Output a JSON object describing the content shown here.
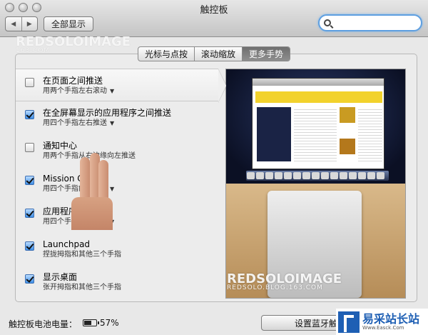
{
  "window": {
    "title": "触控板"
  },
  "toolbar": {
    "back_label": "◀",
    "forward_label": "▶",
    "show_all_label": "全部显示",
    "search_value": "",
    "search_placeholder": ""
  },
  "watermark": {
    "line1": "REDSOLOIMAGE",
    "line2": "163.COM",
    "big_line1": "REDSOLOIMAGE",
    "big_line2": "REDSOLO.BLOG.163.COM"
  },
  "tabs": [
    {
      "label": "光标与点按",
      "active": false
    },
    {
      "label": "滚动缩放",
      "active": false
    },
    {
      "label": "更多手势",
      "active": true
    }
  ],
  "gestures": [
    {
      "title": "在页面之间推送",
      "subtitle": "用两个手指左右滚动",
      "checked": false,
      "has_menu": true,
      "selected": true
    },
    {
      "title": "在全屏幕显示的应用程序之间推送",
      "subtitle": "用四个手指左右推送",
      "checked": true,
      "has_menu": true,
      "selected": false
    },
    {
      "title": "通知中心",
      "subtitle": "用两个手指从右边缘向左推送",
      "checked": false,
      "has_menu": false,
      "selected": false
    },
    {
      "title": "Mission Control",
      "subtitle": "用四个手指向上推送",
      "checked": true,
      "has_menu": true,
      "selected": false
    },
    {
      "title": "应用程序 Exposé",
      "subtitle": "用四个手指向下推送",
      "checked": true,
      "has_menu": true,
      "selected": false
    },
    {
      "title": "Launchpad",
      "subtitle": "捏拢拇指和其他三个手指",
      "checked": true,
      "has_menu": false,
      "selected": false
    },
    {
      "title": "显示桌面",
      "subtitle": "张开拇指和其他三个手指",
      "checked": true,
      "has_menu": false,
      "selected": false
    }
  ],
  "footer": {
    "battery_label": "触控板电池电量：",
    "battery_value": "57%",
    "battery_level": 0.57,
    "bluetooth_button": "设置蓝牙触控板..."
  },
  "logo": {
    "line1": "易采站长站",
    "line2": "Www.Easck.Com"
  },
  "colors": {
    "accent": "#5e9fe0",
    "checkbox_checked": "#3d8ee6",
    "logo_blue": "#1e5fb4"
  },
  "icons": {
    "search": "search-icon",
    "battery": "battery-icon",
    "menu_caret": "chevron-down-icon"
  }
}
